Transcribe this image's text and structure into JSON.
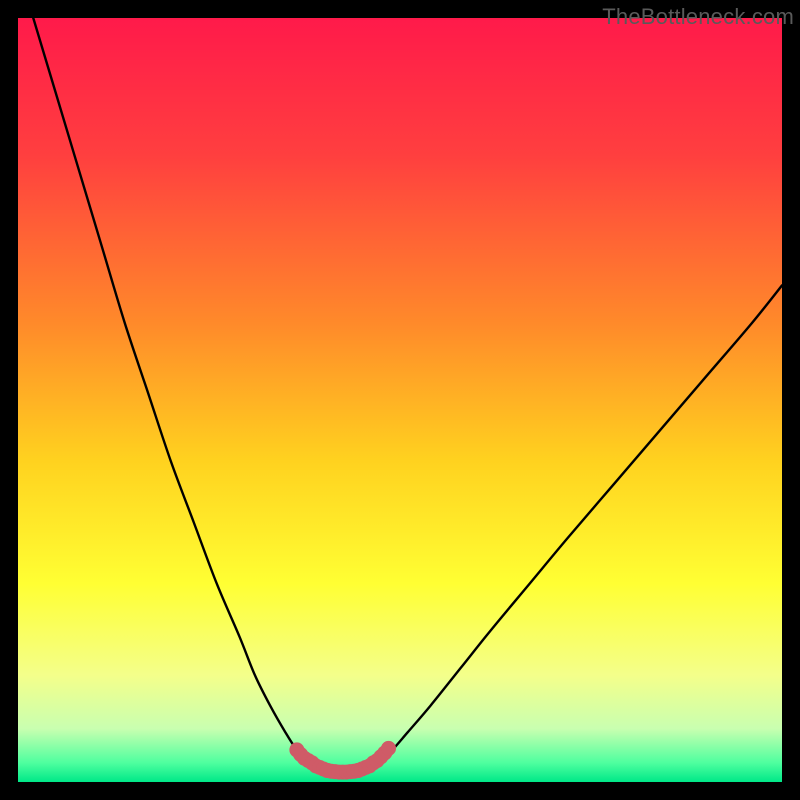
{
  "watermark": "TheBottleneck.com",
  "chart_data": {
    "type": "line",
    "title": "",
    "xlabel": "",
    "ylabel": "",
    "xlim": [
      0,
      100
    ],
    "ylim": [
      0,
      100
    ],
    "grid": false,
    "legend": false,
    "annotations": [],
    "series": [
      {
        "name": "curve-left",
        "x": [
          2,
          5,
          8,
          11,
          14,
          17,
          20,
          23,
          26,
          29,
          31,
          33,
          35,
          36.5,
          38,
          39
        ],
        "y": [
          100,
          90,
          80,
          70,
          60,
          51,
          42,
          34,
          26,
          19,
          14,
          10,
          6.5,
          4.2,
          2.8,
          2.1
        ]
      },
      {
        "name": "curve-right",
        "x": [
          46,
          47.5,
          49,
          51,
          54,
          58,
          62,
          67,
          72,
          78,
          84,
          90,
          96,
          100
        ],
        "y": [
          2.1,
          2.8,
          4.2,
          6.5,
          10,
          15,
          20,
          26,
          32,
          39,
          46,
          53,
          60,
          65
        ]
      },
      {
        "name": "highlight-left",
        "x": [
          36.5,
          37,
          37.5,
          38,
          38.5,
          39,
          39.5,
          40,
          40.5
        ],
        "y": [
          4.2,
          3.6,
          3.1,
          2.8,
          2.5,
          2.1,
          1.9,
          1.7,
          1.5
        ]
      },
      {
        "name": "highlight-bottom",
        "x": [
          40.5,
          41,
          41.5,
          42,
          42.5,
          43,
          43.5,
          44,
          44.5
        ],
        "y": [
          1.5,
          1.4,
          1.35,
          1.3,
          1.3,
          1.3,
          1.35,
          1.4,
          1.5
        ]
      },
      {
        "name": "highlight-right",
        "x": [
          44.5,
          45,
          45.5,
          46,
          46.5,
          47,
          47.5,
          48,
          48.5
        ],
        "y": [
          1.5,
          1.7,
          1.9,
          2.1,
          2.5,
          2.8,
          3.3,
          3.8,
          4.4
        ]
      }
    ],
    "colors": {
      "curve": "#000000",
      "highlight": "#cf5b67",
      "gradient_stops": [
        {
          "offset": 0.0,
          "color": "#ff1a4a"
        },
        {
          "offset": 0.18,
          "color": "#ff3f3f"
        },
        {
          "offset": 0.4,
          "color": "#ff8a2a"
        },
        {
          "offset": 0.58,
          "color": "#ffd21f"
        },
        {
          "offset": 0.74,
          "color": "#ffff33"
        },
        {
          "offset": 0.86,
          "color": "#f4ff8a"
        },
        {
          "offset": 0.93,
          "color": "#c9ffb0"
        },
        {
          "offset": 0.975,
          "color": "#4eff9f"
        },
        {
          "offset": 1.0,
          "color": "#00e888"
        }
      ]
    }
  }
}
